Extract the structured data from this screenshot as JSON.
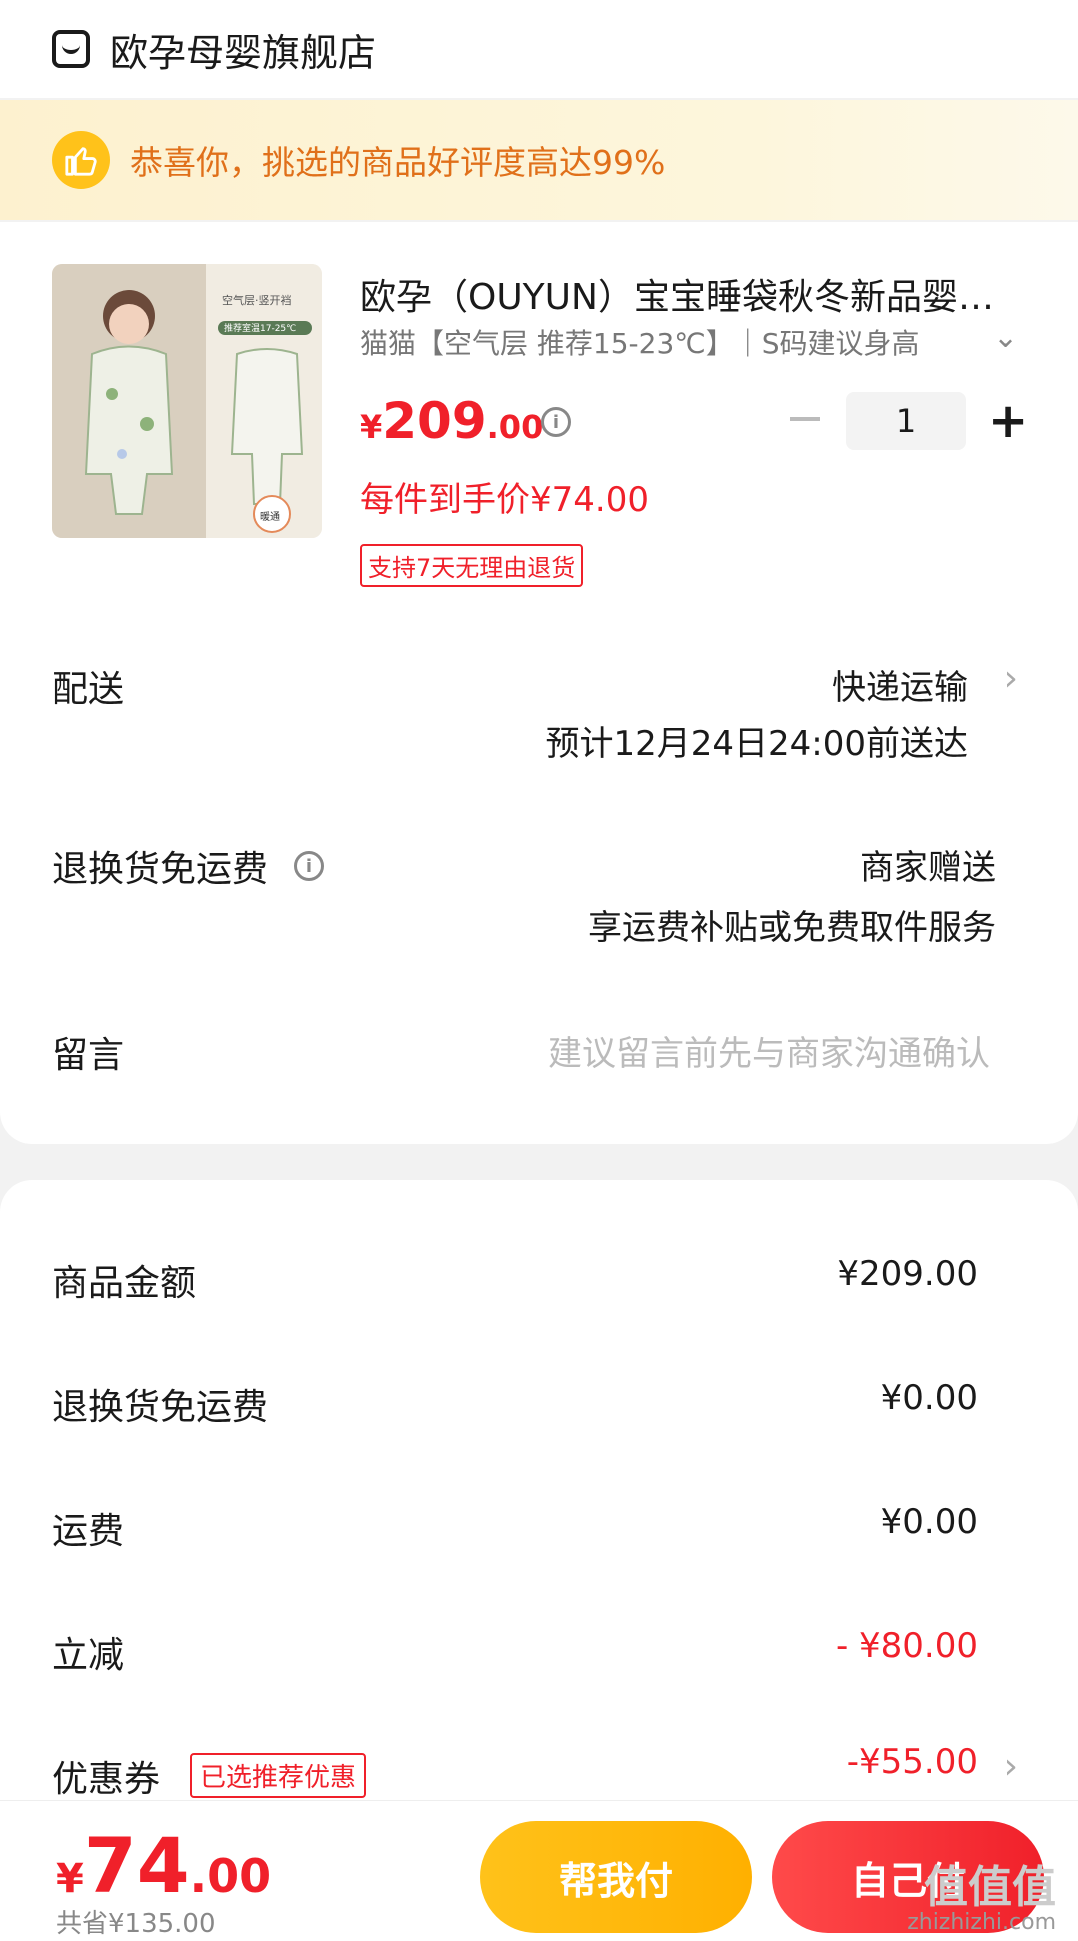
{
  "shop": {
    "name": "欧孕母婴旗舰店"
  },
  "banner": {
    "text": "恭喜你，挑选的商品好评度高达99%"
  },
  "product": {
    "image_texts": [
      "空气层·竖开裆",
      "推荐室温17-25℃",
      "暖通"
    ],
    "title": "欧孕（OUYUN）宝宝睡袋秋冬新品婴儿睡袋分腿式",
    "spec": "猫猫【空气层 推荐15-23℃】｜S码建议身高",
    "price_currency": "¥",
    "price_int": "209",
    "price_dec": ".00",
    "quantity": "1",
    "final_price": "每件到手价¥74.00",
    "return_badge": "支持7天无理由退货"
  },
  "delivery": {
    "label": "配送",
    "method": "快递运输",
    "eta": "预计12月24日24:00前送达"
  },
  "return_freight": {
    "label": "退换货免运费",
    "value": "商家赠送",
    "desc": "享运费补贴或免费取件服务"
  },
  "message": {
    "label": "留言",
    "placeholder": "建议留言前先与商家沟通确认"
  },
  "summary": [
    {
      "label": "商品金额",
      "value": "¥209.00"
    },
    {
      "label": "退换货免运费",
      "value": "¥0.00"
    },
    {
      "label": "运费",
      "value": "¥0.00"
    },
    {
      "label": "立减",
      "value": "- ¥80.00"
    },
    {
      "label": "优惠券",
      "value": "-¥55.00",
      "badge": "已选推荐优惠"
    }
  ],
  "bottom": {
    "total_currency": "¥",
    "total_int": "74",
    "total_dec": ".00",
    "saved": "共省¥135.00",
    "help_pay": "帮我付",
    "self_pay": "自己付",
    "watermark_big": "值值值",
    "watermark_small": "zhizhizhi.com"
  },
  "colors": {
    "accent_red": "#f0202a",
    "accent_yellow": "#ffc21a",
    "banner_text": "#e0701a"
  }
}
